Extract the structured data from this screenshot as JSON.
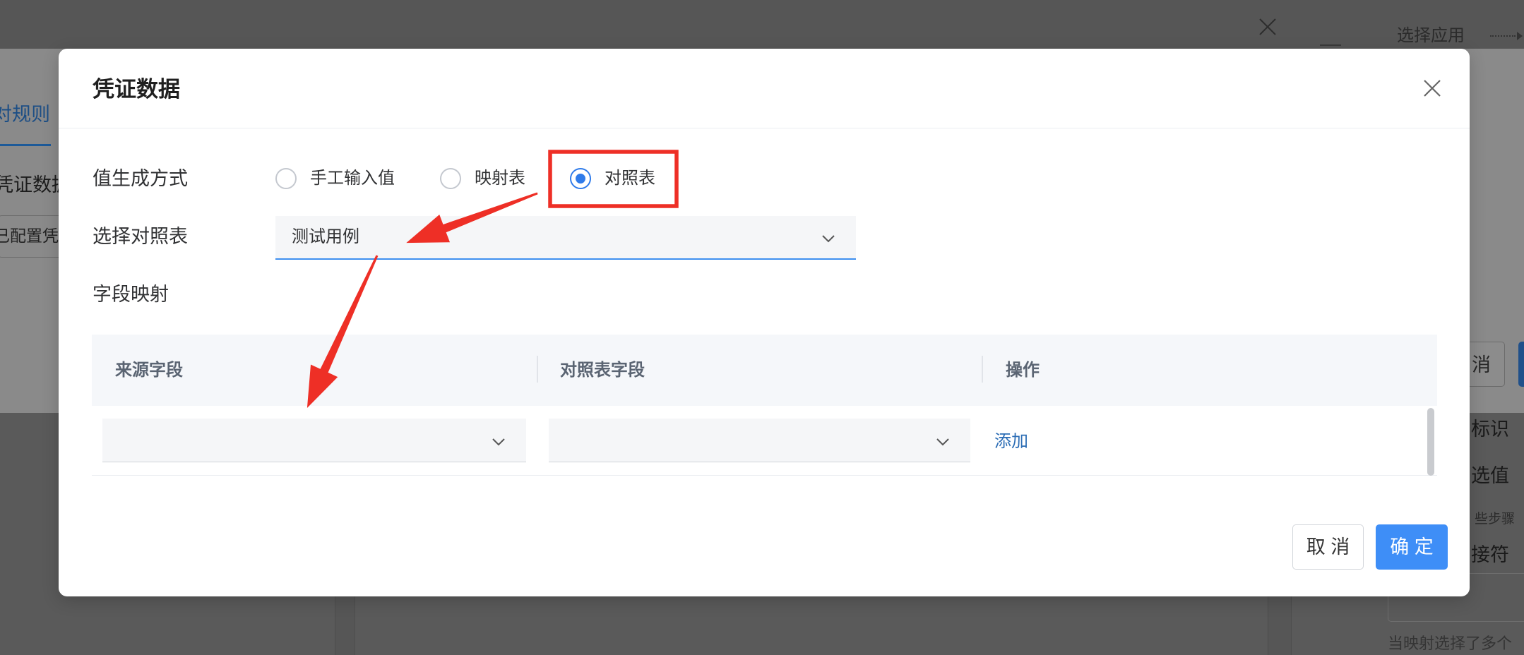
{
  "page": {
    "top_bar": {
      "step_label": "选择应用"
    },
    "underlying_modal": {
      "tab_label": "对规则",
      "section_label": "凭证数据",
      "configured_label": "已配置凭",
      "cancel_button_label": "消"
    },
    "right_panel": {
      "field_labels": [
        "标识",
        "选值",
        "接符"
      ],
      "step_hint": "些步骤",
      "mapping_hint": "当映射选择了多个"
    }
  },
  "dialog": {
    "title": "凭证数据",
    "value_mode": {
      "label": "值生成方式",
      "options": [
        {
          "label": "手工输入值",
          "selected": false
        },
        {
          "label": "映射表",
          "selected": false
        },
        {
          "label": "对照表",
          "selected": true
        }
      ]
    },
    "lookup_table": {
      "label": "选择对照表",
      "value": "测试用例"
    },
    "field_mapping": {
      "label": "字段映射",
      "columns": [
        "来源字段",
        "对照表字段",
        "操作"
      ],
      "rows": [
        {
          "source": "",
          "target": "",
          "action": "添加"
        }
      ]
    },
    "footer": {
      "cancel_label": "取 消",
      "confirm_label": "确 定"
    }
  },
  "icons": {
    "dialog_close": "close-icon",
    "page_close": "close-icon",
    "dropdown": "chevron-down-icon",
    "step_connector": "dotted-arrow-icon"
  },
  "colors": {
    "accent": "#2f7bea",
    "select_underline": "#3f8ff0",
    "primary_button": "#3e8ef7",
    "link": "#2c6db5",
    "annotation": "#ee2f26"
  }
}
